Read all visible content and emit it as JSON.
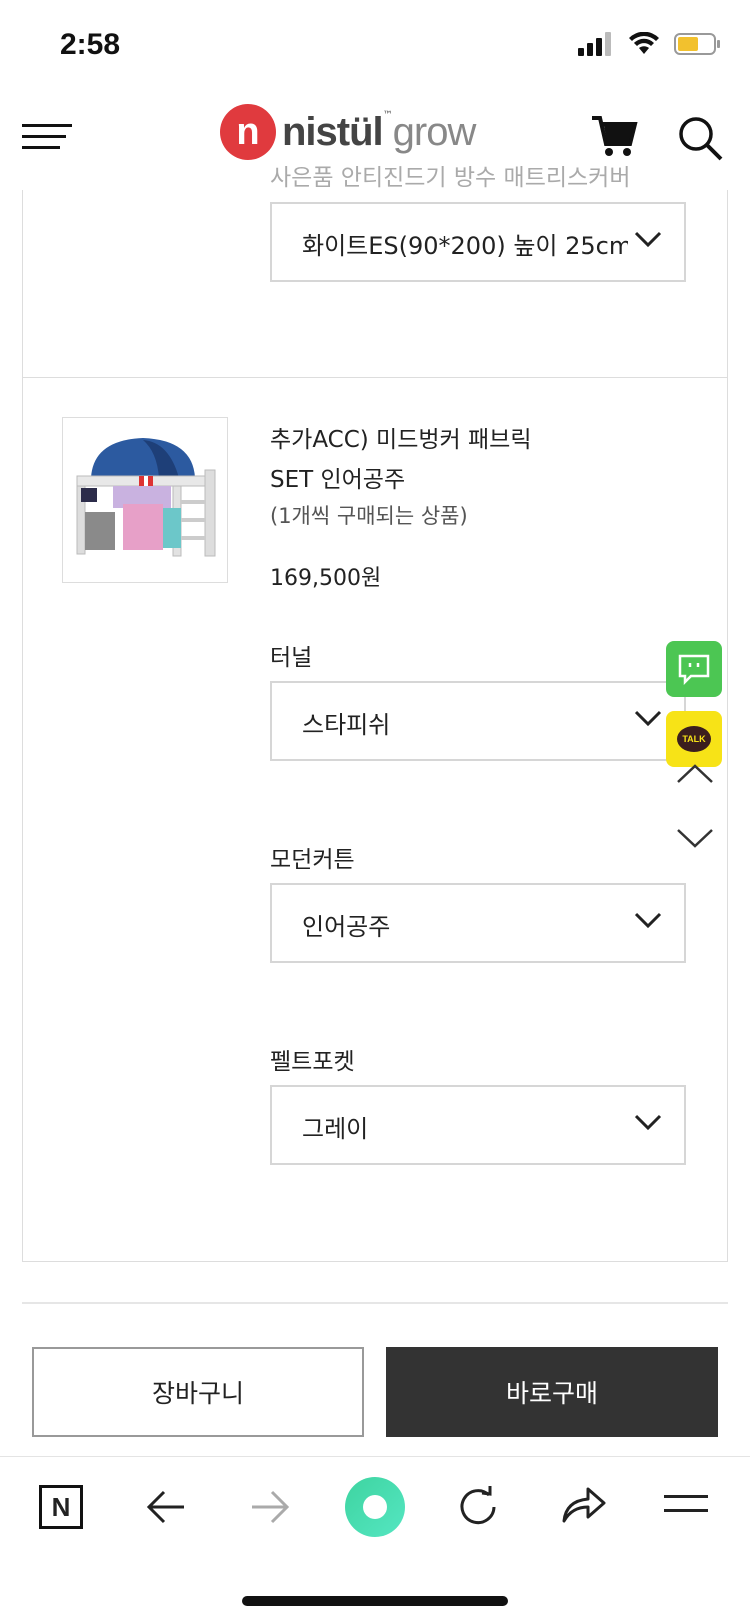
{
  "status": {
    "time": "2:58"
  },
  "header": {
    "logo_initial": "n",
    "logo_name": "nistül",
    "logo_suffix": "grow",
    "logo_tm": "™"
  },
  "prev_option": {
    "faded_label": "사은품 안티진드기 방수 매트리스커버",
    "selected": "화이트ES(90*200) 높이 25cm"
  },
  "product": {
    "name_line1": "추가ACC) 미드벙커 패브릭",
    "name_line2": "SET 인어공주",
    "note": "(1개씩 구매되는 상품)",
    "price": "169,500원",
    "options": [
      {
        "label": "터널",
        "value": "스타피쉬"
      },
      {
        "label": "모던커튼",
        "value": "인어공주"
      },
      {
        "label": "펠트포켓",
        "value": "그레이"
      }
    ]
  },
  "actions": {
    "cart": "장바구니",
    "buy": "바로구매"
  },
  "floating": {
    "talk": "TALK"
  },
  "browser": {
    "n_label": "N"
  },
  "colors": {
    "buy_bg": "#333333",
    "chat_green": "#4cc653",
    "talk_yellow": "#f7e317",
    "logo_red": "#e03a3e",
    "browser_green": "#3fd39a"
  }
}
